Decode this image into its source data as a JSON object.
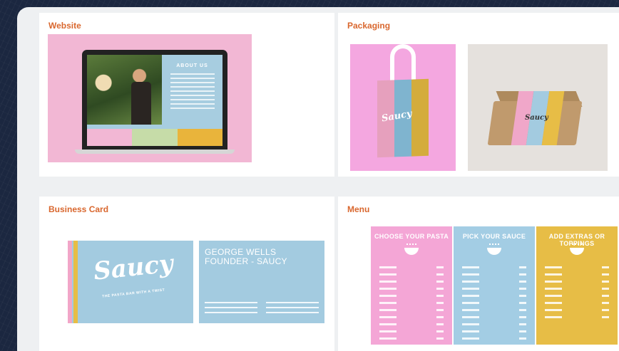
{
  "panels": {
    "website": {
      "title": "Website",
      "screen_heading": "ABOUT US"
    },
    "packaging": {
      "title": "Packaging",
      "bag_logo": "Saucy",
      "box_logo": "Saucy"
    },
    "business_card": {
      "title": "Business Card",
      "logo": "Saucy",
      "tagline": "THE PASTA BAR WITH A TWIST",
      "name": "GEORGE WELLS",
      "role": "FOUNDER - SAUCY"
    },
    "menu": {
      "title": "Menu",
      "columns": [
        "CHOOSE YOUR PASTA",
        "PICK YOUR SAUCE",
        "ADD EXTRAS OR TOPPINGS"
      ]
    }
  },
  "colors": {
    "pink": "#f2b7d4",
    "blue": "#a3cbe0",
    "yellow": "#e7bd46",
    "title_orange": "#d9672e"
  }
}
